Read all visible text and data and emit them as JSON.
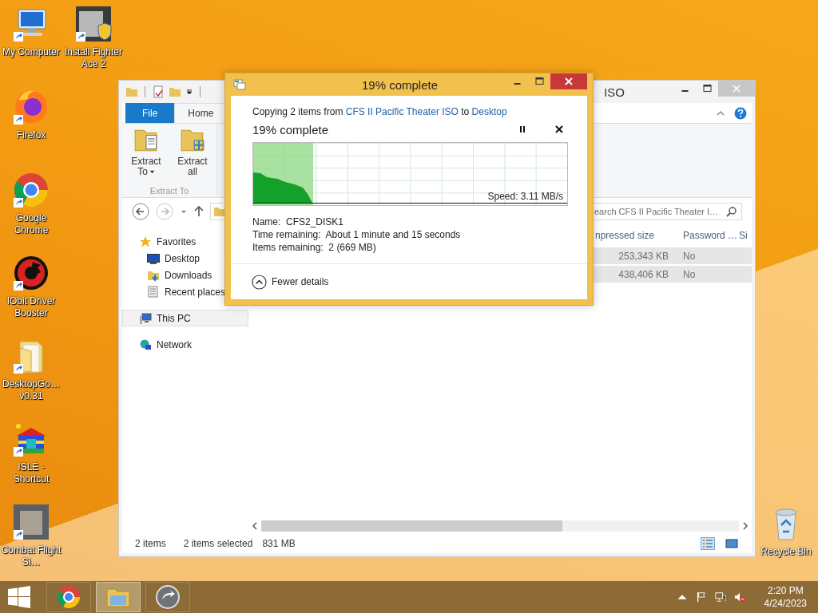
{
  "desktop_icons": [
    {
      "kind": "computer",
      "label": "My Computer"
    },
    {
      "kind": "installer",
      "label": "Install Fighter Ace 2"
    },
    {
      "kind": "firefox",
      "label": "Firefox"
    },
    {
      "kind": "chrome",
      "label": "Google Chrome"
    },
    {
      "kind": "booster",
      "label": "IObit Driver Booster"
    },
    {
      "kind": "folder",
      "label": "DesktopGo… v0.31"
    },
    {
      "kind": "house",
      "label": "ISLE - Shortcut"
    },
    {
      "kind": "picture",
      "label": "Combat Flight Si…"
    }
  ],
  "recycle_bin": {
    "label": "Recycle Bin"
  },
  "explorer": {
    "title": "ISO",
    "ribbon_tabs": [
      {
        "label": "File",
        "kind": "menu",
        "selected": false
      },
      {
        "label": "Home",
        "kind": "tab",
        "selected": true
      }
    ],
    "ribbon_buttons": [
      {
        "label": "Extract To",
        "kind": "extract-to",
        "dropdown": true
      },
      {
        "label": "Extract all",
        "kind": "extract-all",
        "dropdown": false
      }
    ],
    "ribbon_group": "Extract To",
    "search": {
      "placeholder": "earch CFS II Pacific Theater I…"
    },
    "nav_pane": [
      {
        "label": "Favorites",
        "kind": "favorites",
        "selected": false,
        "children": [
          {
            "label": "Desktop",
            "kind": "desktop",
            "selected": false
          },
          {
            "label": "Downloads",
            "kind": "downloads",
            "selected": false
          },
          {
            "label": "Recent places",
            "kind": "recent",
            "selected": false
          }
        ]
      },
      {
        "label": "This PC",
        "kind": "pc",
        "selected": true
      },
      {
        "label": "Network",
        "kind": "network",
        "selected": false
      }
    ],
    "columns": [
      "npressed size",
      "Password …",
      "Si"
    ],
    "rows": [
      {
        "cells": [
          "253,343 KB",
          "No"
        ],
        "selected": true
      },
      {
        "cells": [
          "438,406 KB",
          "No"
        ],
        "selected": true
      }
    ],
    "status": {
      "count": "2 items",
      "selection": "2 items selected",
      "size": "831 MB"
    }
  },
  "copy_dialog": {
    "title": "19% complete",
    "summary": [
      {
        "kind": "text",
        "text": "Copying 2 items from"
      },
      {
        "kind": "link",
        "text": "CFS II Pacific Theater ISO"
      },
      {
        "kind": "text",
        "text": "to"
      },
      {
        "kind": "link",
        "text": "Desktop"
      }
    ],
    "heading": "19% complete",
    "progress": {
      "level": 0.19
    },
    "speed": "Speed: 3.11 MB/s",
    "details": [
      "Name:  CFS2_DISK1",
      "Time remaining:  About 1 minute and 15 seconds",
      "Items remaining:  2 (669 MB)"
    ],
    "details_toggle": "Fewer details"
  },
  "taskbar": {
    "apps": [
      {
        "kind": "chrome",
        "selected": false
      },
      {
        "kind": "explorer",
        "selected": true
      },
      {
        "kind": "app",
        "selected": false
      }
    ],
    "volume_muted": true,
    "time": "2:20 PM",
    "date": "4/24/2023"
  }
}
